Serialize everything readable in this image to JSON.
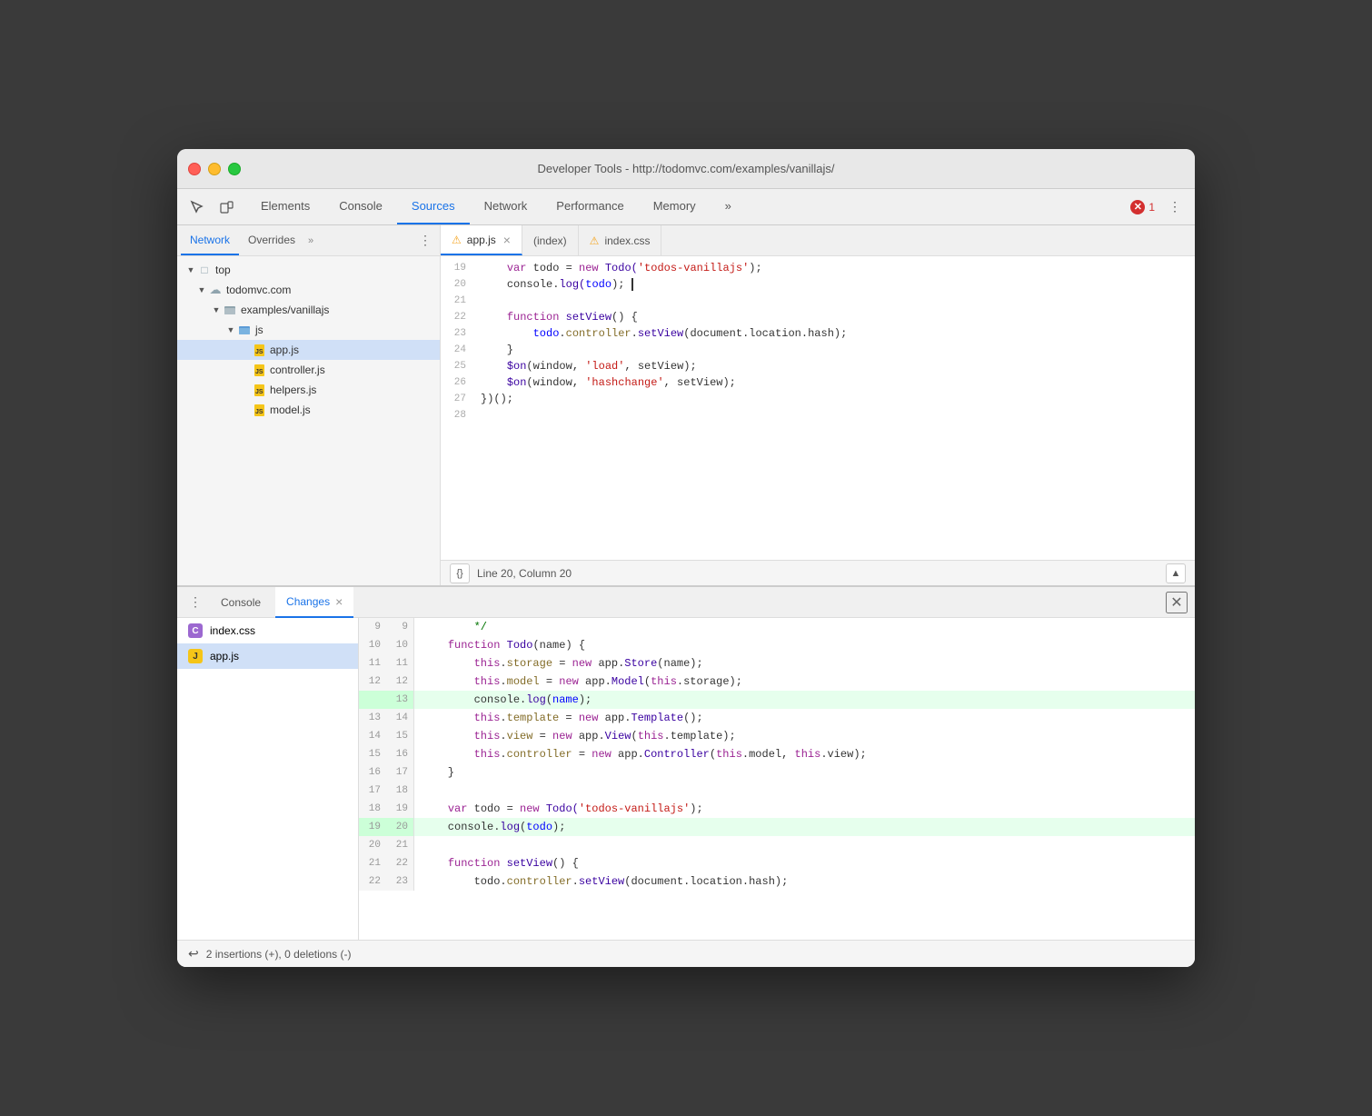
{
  "window": {
    "title": "Developer Tools - http://todomvc.com/examples/vanillajs/"
  },
  "traffic_lights": {
    "close": "close",
    "minimize": "minimize",
    "maximize": "maximize"
  },
  "tabs": [
    {
      "label": "Elements",
      "active": false
    },
    {
      "label": "Console",
      "active": false
    },
    {
      "label": "Sources",
      "active": true
    },
    {
      "label": "Network",
      "active": false
    },
    {
      "label": "Performance",
      "active": false
    },
    {
      "label": "Memory",
      "active": false
    },
    {
      "label": "»",
      "active": false
    }
  ],
  "error_count": "1",
  "sidebar": {
    "tabs": [
      {
        "label": "Network",
        "active": true
      },
      {
        "label": "Overrides",
        "active": false
      },
      {
        "label": "»",
        "active": false
      }
    ],
    "tree": [
      {
        "level": 0,
        "type": "folder",
        "arrow": "expanded",
        "label": "top"
      },
      {
        "level": 1,
        "type": "cloud",
        "arrow": "expanded",
        "label": "todomvc.com"
      },
      {
        "level": 2,
        "type": "folder",
        "arrow": "expanded",
        "label": "examples/vanillajs"
      },
      {
        "level": 3,
        "type": "folder-blue",
        "arrow": "expanded",
        "label": "js"
      },
      {
        "level": 4,
        "type": "file-js",
        "arrow": "leaf",
        "label": "app.js",
        "selected": true
      },
      {
        "level": 4,
        "type": "file-js",
        "arrow": "leaf",
        "label": "controller.js"
      },
      {
        "level": 4,
        "type": "file-js",
        "arrow": "leaf",
        "label": "helpers.js"
      },
      {
        "level": 4,
        "type": "file-js",
        "arrow": "leaf",
        "label": "model.js"
      }
    ]
  },
  "editor_tabs": [
    {
      "label": "app.js",
      "warning": true,
      "active": true,
      "closable": true
    },
    {
      "label": "(index)",
      "warning": false,
      "active": false,
      "closable": false
    },
    {
      "label": "index.css",
      "warning": true,
      "active": false,
      "closable": false
    }
  ],
  "code_lines": [
    {
      "num": "19",
      "tokens": [
        {
          "t": "    "
        },
        {
          "t": "var ",
          "c": "kw"
        },
        {
          "t": "todo = ",
          "c": ""
        },
        {
          "t": "new ",
          "c": "kw"
        },
        {
          "t": "Todo(",
          "c": "fn"
        },
        {
          "t": "'todos-vanillajs'",
          "c": "str"
        },
        {
          "t": ");"
        },
        {
          "t": ""
        }
      ]
    },
    {
      "num": "20",
      "tokens": [
        {
          "t": "    "
        },
        {
          "t": "console",
          "c": ""
        },
        {
          "t": "."
        },
        {
          "t": "log(",
          "c": "fn"
        },
        {
          "t": "todo",
          "c": "var-c"
        },
        {
          "t": "); ",
          "c": ""
        },
        {
          "cursor": true
        }
      ]
    },
    {
      "num": "21",
      "tokens": []
    },
    {
      "num": "22",
      "tokens": [
        {
          "t": "    "
        },
        {
          "t": "function ",
          "c": "kw"
        },
        {
          "t": "setView",
          "c": "fn"
        },
        {
          "t": "() {"
        }
      ]
    },
    {
      "num": "23",
      "tokens": [
        {
          "t": "        "
        },
        {
          "t": "todo",
          "c": "var-c"
        },
        {
          "t": "."
        },
        {
          "t": "controller",
          "c": "prop"
        },
        {
          "t": "."
        },
        {
          "t": "setView",
          "c": "fn"
        },
        {
          "t": "(document.location.hash);"
        }
      ]
    },
    {
      "num": "24",
      "tokens": [
        {
          "t": "    }"
        }
      ]
    },
    {
      "num": "25",
      "tokens": [
        {
          "t": "    "
        },
        {
          "t": "$on(window, ",
          "c": "fn"
        },
        {
          "t": "'load'",
          "c": "str"
        },
        {
          "t": ", setView);"
        },
        {
          "t": ""
        }
      ]
    },
    {
      "num": "26",
      "tokens": [
        {
          "t": "    "
        },
        {
          "t": "$on(window, ",
          "c": "fn"
        },
        {
          "t": "'hashchange'",
          "c": "str"
        },
        {
          "t": ", setView);"
        },
        {
          "t": ""
        }
      ]
    },
    {
      "num": "27",
      "tokens": [
        {
          "t": "})();"
        }
      ]
    },
    {
      "num": "28",
      "tokens": []
    }
  ],
  "status_bar": {
    "format_label": "{}",
    "position": "Line 20, Column 20"
  },
  "bottom_panel": {
    "tabs": [
      {
        "label": "Console",
        "active": false
      },
      {
        "label": "Changes",
        "active": true,
        "closable": true
      }
    ],
    "files": [
      {
        "name": "index.css",
        "type": "css",
        "selected": false
      },
      {
        "name": "app.js",
        "type": "js",
        "selected": true
      }
    ],
    "diff_lines": [
      {
        "old_num": "9",
        "new_num": "9",
        "type": "context",
        "content": "    */"
      },
      {
        "old_num": "10",
        "new_num": "10",
        "type": "context",
        "content": "    function Todo(name) {"
      },
      {
        "old_num": "11",
        "new_num": "11",
        "type": "context",
        "content": "        this.storage = new app.Store(name);"
      },
      {
        "old_num": "12",
        "new_num": "12",
        "type": "context",
        "content": "        this.model = new app.Model(this.storage);"
      },
      {
        "old_num": "",
        "new_num": "13",
        "type": "added",
        "content": "        console.log(name);"
      },
      {
        "old_num": "13",
        "new_num": "14",
        "type": "context",
        "content": "        this.template = new app.Template();"
      },
      {
        "old_num": "14",
        "new_num": "15",
        "type": "context",
        "content": "        this.view = new app.View(this.template);"
      },
      {
        "old_num": "15",
        "new_num": "16",
        "type": "context",
        "content": "        this.controller = new app.Controller(this.model, this.view);"
      },
      {
        "old_num": "16",
        "new_num": "17",
        "type": "context",
        "content": "    }"
      },
      {
        "old_num": "17",
        "new_num": "18",
        "type": "context",
        "content": ""
      },
      {
        "old_num": "18",
        "new_num": "19",
        "type": "context",
        "content": "    var todo = new Todo('todos-vanillajs');"
      },
      {
        "old_num": "19",
        "new_num": "20",
        "type": "added",
        "content": "    console.log(todo);"
      },
      {
        "old_num": "20",
        "new_num": "21",
        "type": "context",
        "content": ""
      },
      {
        "old_num": "21",
        "new_num": "22",
        "type": "context",
        "content": "    function setView() {"
      },
      {
        "old_num": "22",
        "new_num": "23",
        "type": "context",
        "content": "        todo.controller.setView(document.location.hash);"
      }
    ],
    "summary": "2 insertions (+), 0 deletions (-)",
    "undo_label": "↩"
  }
}
